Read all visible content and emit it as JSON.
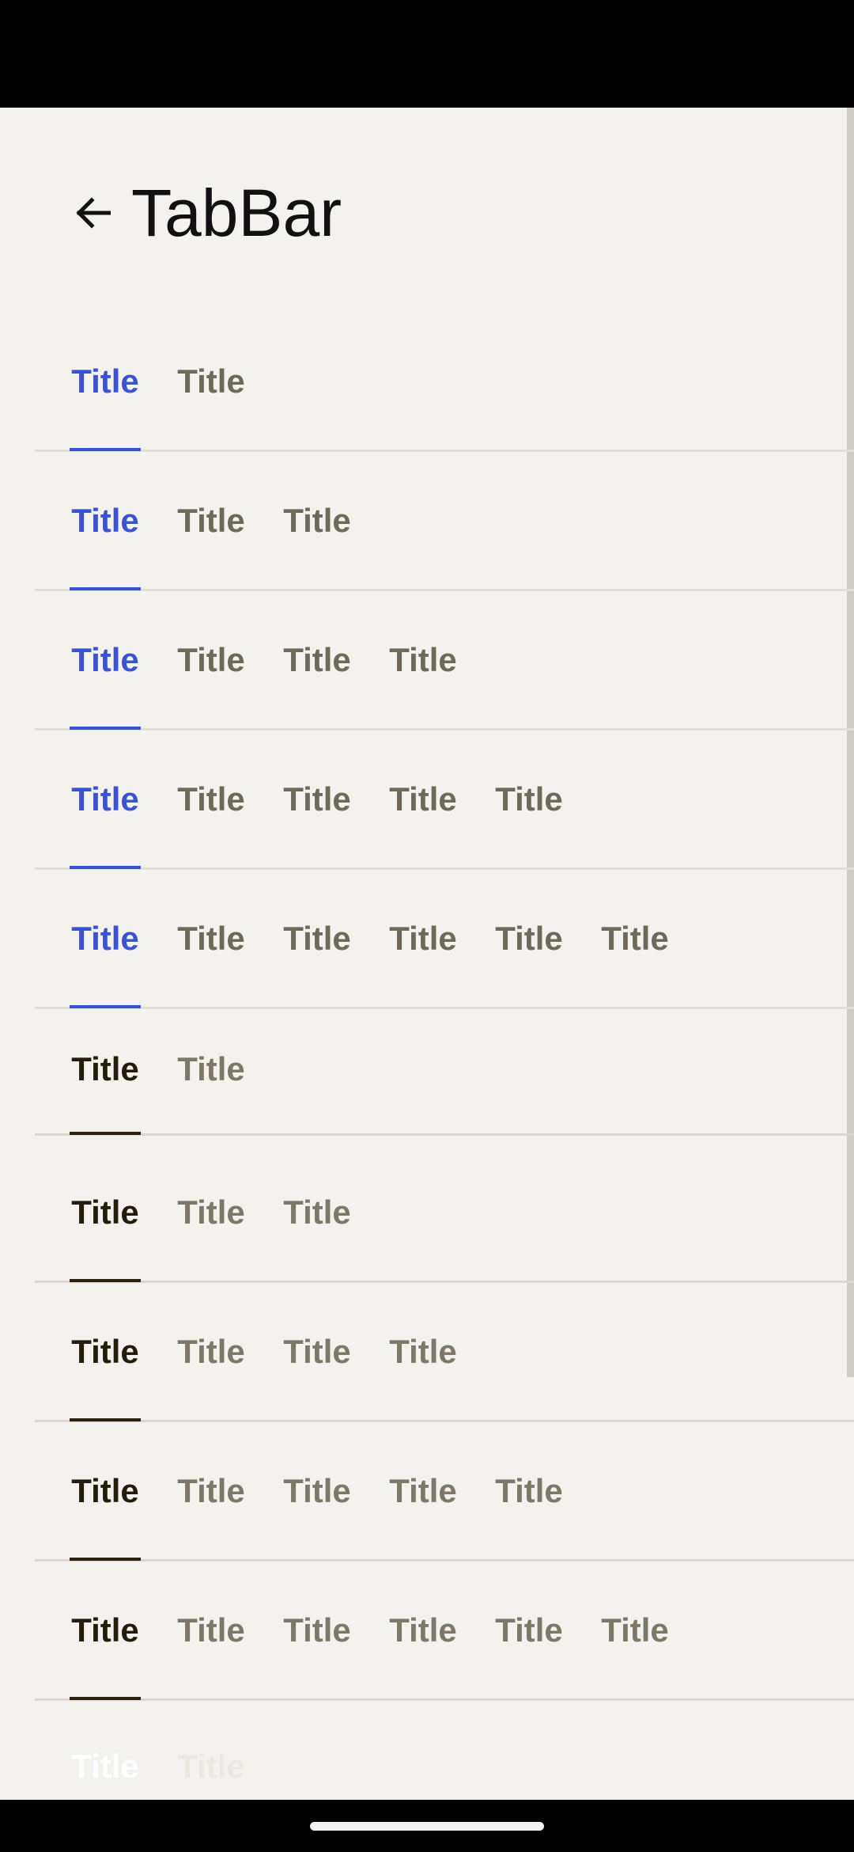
{
  "header": {
    "title": "TabBar",
    "back_icon": "arrow-left-icon"
  },
  "colors": {
    "background": "#f4f2ef",
    "accent_blue": "#3a52d6",
    "inactive_text": "#6e6a5a",
    "dark_active": "#251d0c"
  },
  "tab_label": "Title",
  "tabbars": [
    {
      "variant": "blue",
      "tabs": [
        "Title",
        "Title"
      ],
      "active_index": 0
    },
    {
      "variant": "blue",
      "tabs": [
        "Title",
        "Title",
        "Title"
      ],
      "active_index": 0
    },
    {
      "variant": "blue",
      "tabs": [
        "Title",
        "Title",
        "Title",
        "Title"
      ],
      "active_index": 0
    },
    {
      "variant": "blue",
      "tabs": [
        "Title",
        "Title",
        "Title",
        "Title",
        "Title"
      ],
      "active_index": 0
    },
    {
      "variant": "blue",
      "tabs": [
        "Title",
        "Title",
        "Title",
        "Title",
        "Title",
        "Title"
      ],
      "active_index": 0
    },
    {
      "variant": "dark",
      "tabs": [
        "Title",
        "Title"
      ],
      "active_index": 0
    },
    {
      "variant": "dark",
      "tabs": [
        "Title",
        "Title",
        "Title"
      ],
      "active_index": 0
    },
    {
      "variant": "dark",
      "tabs": [
        "Title",
        "Title",
        "Title",
        "Title"
      ],
      "active_index": 0
    },
    {
      "variant": "dark",
      "tabs": [
        "Title",
        "Title",
        "Title",
        "Title",
        "Title"
      ],
      "active_index": 0
    },
    {
      "variant": "dark",
      "tabs": [
        "Title",
        "Title",
        "Title",
        "Title",
        "Title",
        "Title"
      ],
      "active_index": 0
    },
    {
      "variant": "light",
      "tabs": [
        "Title",
        "Title"
      ],
      "active_index": 0
    }
  ]
}
